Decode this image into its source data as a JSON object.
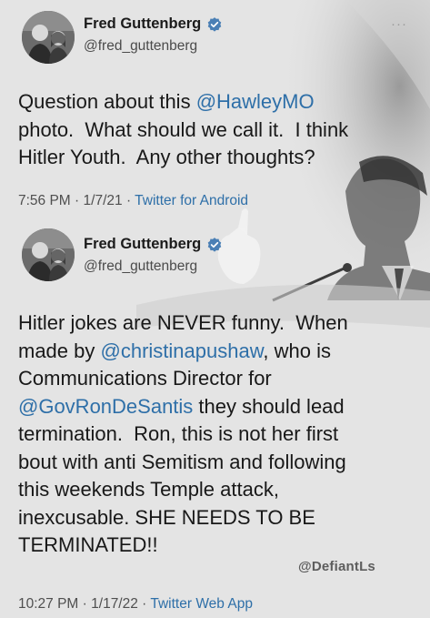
{
  "tweet1": {
    "display_name": "Fred Guttenberg",
    "handle": "@fred_guttenberg",
    "text_parts": [
      {
        "t": "Question about this "
      },
      {
        "t": "@HawleyMO",
        "m": true
      },
      {
        "t": "\nphoto.  What should we call it.  I think\nHitler Youth.  Any other thoughts?"
      }
    ],
    "time": "7:56 PM",
    "date": "1/7/21",
    "source": "Twitter for Android",
    "more_label": "···"
  },
  "tweet2": {
    "display_name": "Fred Guttenberg",
    "handle": "@fred_guttenberg",
    "text_parts": [
      {
        "t": "Hitler jokes are NEVER funny.  When\nmade by "
      },
      {
        "t": "@christinapushaw",
        "m": true
      },
      {
        "t": ", who is\nCommunications Director for\n"
      },
      {
        "t": "@GovRonDeSantis",
        "m": true
      },
      {
        "t": " they should lead\ntermination.  Ron, this is not her first\nbout with anti Semitism and following\nthis weekends Temple attack,\ninexcusable. SHE NEEDS TO BE\nTERMINATED!!"
      }
    ],
    "time": "10:27 PM",
    "date": "1/17/22",
    "source": "Twitter Web App"
  },
  "watermark": "@DefiantLs",
  "colors": {
    "mention": "#2e6fa8",
    "verified": "#4a7fb5",
    "text": "#181818"
  },
  "icons": {
    "verified": "verified-badge-icon",
    "more": "more-options-icon"
  }
}
